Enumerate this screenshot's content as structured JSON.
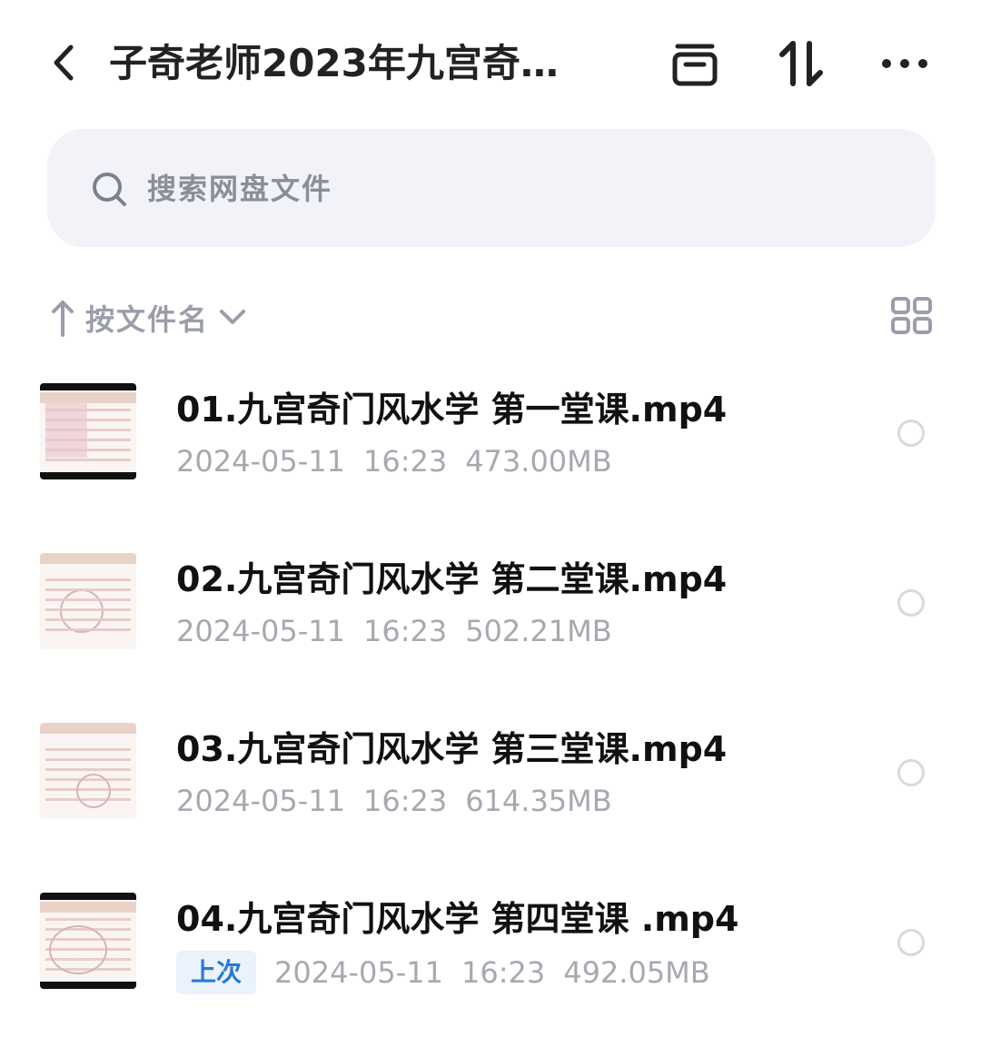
{
  "header": {
    "title": "子奇老师2023年九宫奇…",
    "icons": {
      "back": "chevron-left-icon",
      "archive": "archive-box-icon",
      "sort": "sort-arrows-icon",
      "more": "more-dots-icon"
    }
  },
  "search": {
    "placeholder": "搜索网盘文件",
    "icon": "search-icon"
  },
  "sortbar": {
    "label": "按文件名",
    "direction_icon": "arrow-up-icon",
    "dropdown_icon": "chevron-down-icon",
    "view_toggle_icon": "grid-view-icon"
  },
  "files": [
    {
      "name": "01.九宫奇门风水学 第一堂课.mp4",
      "date": "2024-05-11",
      "time": "16:23",
      "size": "473.00MB",
      "badge": ""
    },
    {
      "name": "02.九宫奇门风水学 第二堂课.mp4",
      "date": "2024-05-11",
      "time": "16:23",
      "size": "502.21MB",
      "badge": ""
    },
    {
      "name": "03.九宫奇门风水学 第三堂课.mp4",
      "date": "2024-05-11",
      "time": "16:23",
      "size": "614.35MB",
      "badge": ""
    },
    {
      "name": "04.九宫奇门风水学 第四堂课 .mp4",
      "date": "2024-05-11",
      "time": "16:23",
      "size": "492.05MB",
      "badge": "上次"
    }
  ],
  "colors": {
    "search_bg": "#f2f3f8",
    "meta_text": "#a6a9b0",
    "badge_bg": "#eaf2fb",
    "badge_text": "#2a78d6"
  }
}
